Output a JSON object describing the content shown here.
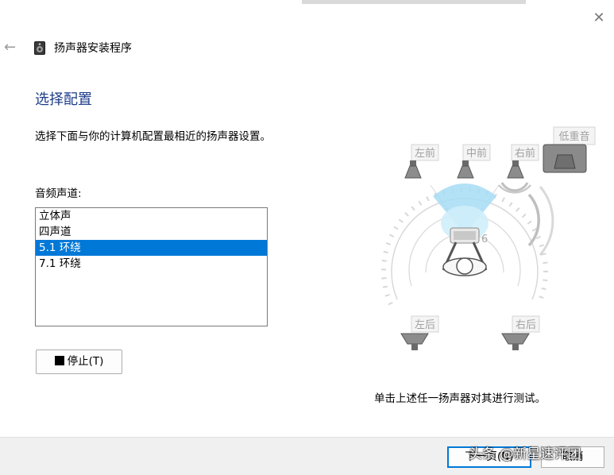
{
  "app_title": "扬声器安装程序",
  "heading": "选择配置",
  "description": "选择下面与你的计算机配置最相近的扬声器设置。",
  "channels_label": "音频声道:",
  "channels": [
    {
      "label": "立体声",
      "selected": false
    },
    {
      "label": "四声道",
      "selected": false
    },
    {
      "label": "5.1 环绕",
      "selected": true
    },
    {
      "label": "7.1 环绕",
      "selected": false
    }
  ],
  "stop_button": "停止(T)",
  "speakers": {
    "front_left": "左前",
    "front_center": "中前",
    "front_right": "右前",
    "subwoofer": "低重音",
    "rear_left": "左后",
    "rear_right": "右后"
  },
  "hint": "单击上述任一扬声器对其进行测试。",
  "next_button": "下一页(N)",
  "cancel_button": "取消",
  "watermark": "头条 @新星速评团",
  "colors": {
    "accent": "#0078d7",
    "heading": "#1e3d8a"
  },
  "icons": {
    "back": "back-arrow-icon",
    "close": "close-icon",
    "app": "speaker-icon"
  }
}
